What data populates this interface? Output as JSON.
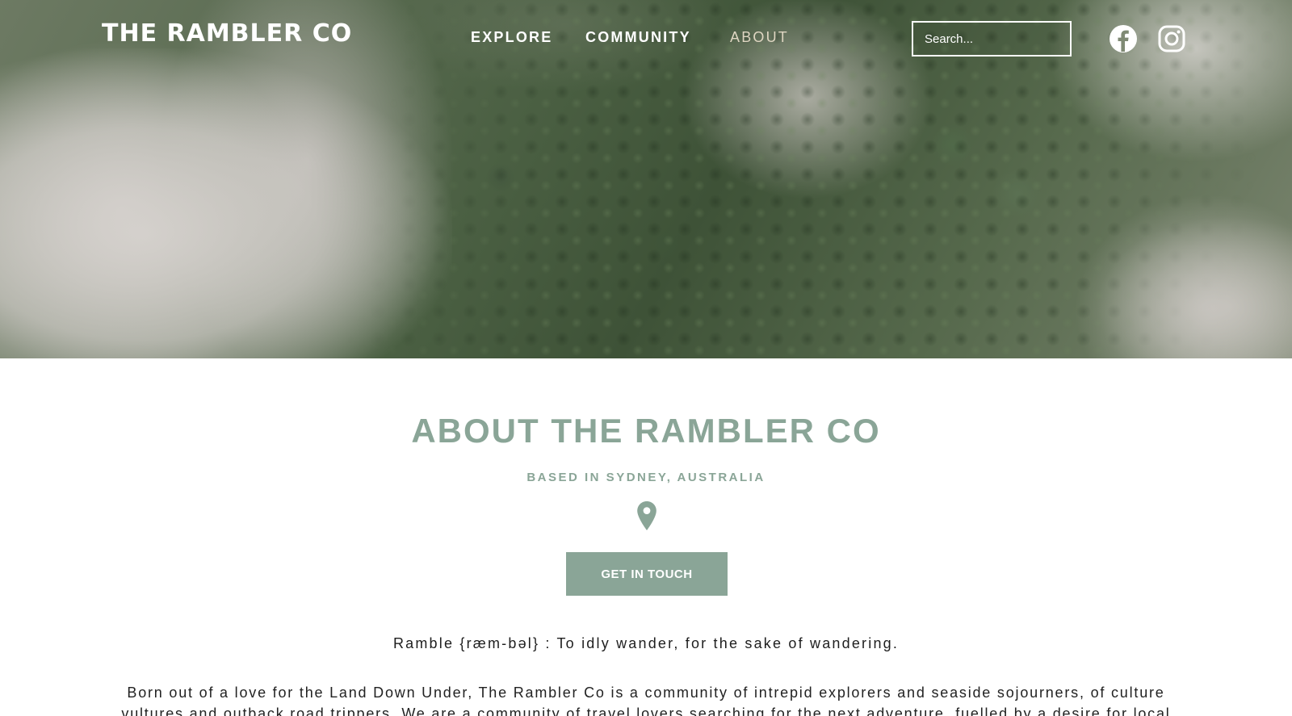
{
  "header": {
    "logo": "THE RAMBLER CO",
    "nav": [
      {
        "label": "EXPLORE",
        "active": false
      },
      {
        "label": "COMMUNITY",
        "active": false
      },
      {
        "label": "ABOUT",
        "active": true
      }
    ],
    "search_placeholder": "Search...",
    "social": [
      {
        "icon": "facebook-icon"
      },
      {
        "icon": "instagram-icon"
      }
    ]
  },
  "hero": {
    "image": "misty-forest-aerial"
  },
  "about": {
    "title": "ABOUT THE RAMBLER CO",
    "subtitle": "BASED IN SYDNEY, AUSTRALIA",
    "location_icon": "map-pin-icon",
    "cta_label": "GET IN TOUCH",
    "definition": "Ramble {ræm-bəl} : To idly wander, for the sake of wandering.",
    "body": "Born out of a love for the Land Down Under, The Rambler Co is a community of intrepid explorers and seaside sojourners, of culture vultures and outback road trippers. We are a community of travel lovers searching for the next adventure, fuelled by a desire for local"
  },
  "colors": {
    "accent": "#8aa597",
    "active_nav": "#dfd6c2",
    "text": "#222222",
    "background": "#ffffff"
  }
}
